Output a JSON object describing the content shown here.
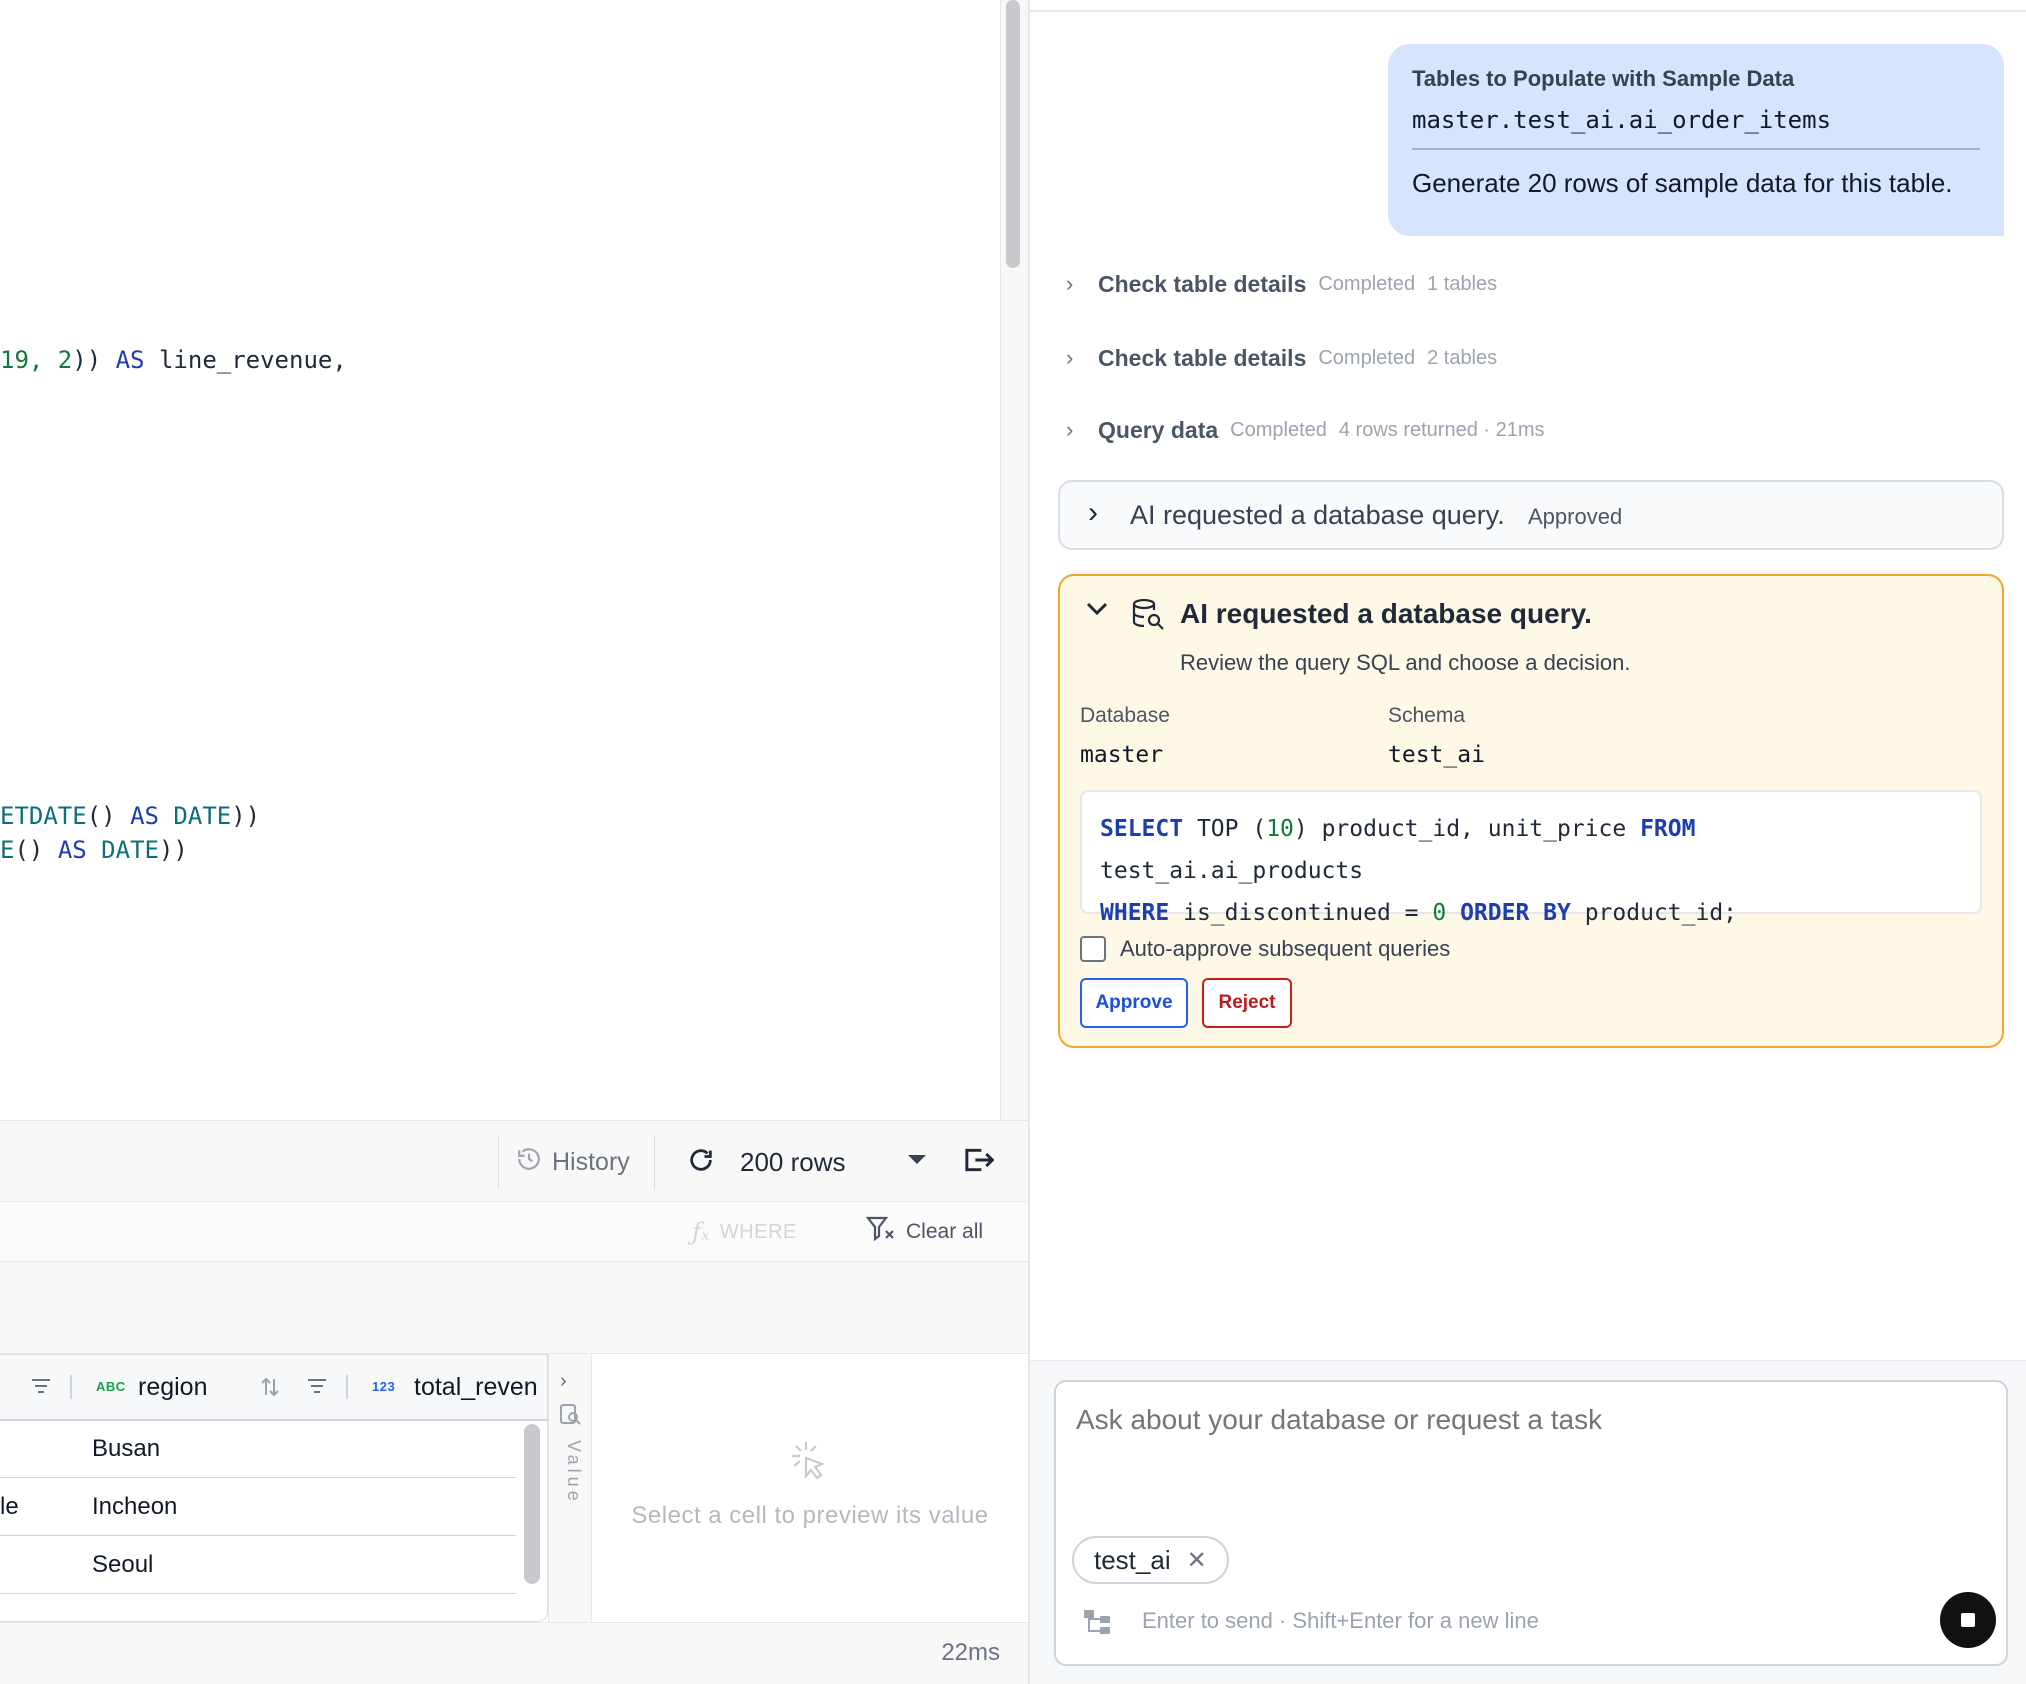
{
  "editor": {
    "lines": [
      {
        "segments": [
          {
            "t": "19, ",
            "c": "num"
          },
          {
            "t": "2",
            "c": "num"
          },
          {
            "t": ")) ",
            "c": ""
          },
          {
            "t": "AS",
            "c": "kw"
          },
          {
            "t": " line_revenue,",
            "c": ""
          }
        ]
      },
      {
        "segments": [
          {
            "t": "ETDATE",
            "c": "fn"
          },
          {
            "t": "() ",
            "c": ""
          },
          {
            "t": "AS",
            "c": "kw"
          },
          {
            "t": " ",
            "c": ""
          },
          {
            "t": "DATE",
            "c": "fn"
          },
          {
            "t": "))",
            "c": ""
          }
        ]
      },
      {
        "segments": [
          {
            "t": "E",
            "c": "fn"
          },
          {
            "t": "() ",
            "c": ""
          },
          {
            "t": "AS",
            "c": "kw"
          },
          {
            "t": " ",
            "c": ""
          },
          {
            "t": "DATE",
            "c": "fn"
          },
          {
            "t": "))",
            "c": ""
          }
        ]
      }
    ]
  },
  "toolbar": {
    "history_label": "History",
    "rows_label": "200 rows"
  },
  "filterbar": {
    "where_label": "WHERE",
    "clear_all_label": "Clear all"
  },
  "grid": {
    "columns": [
      {
        "type_badge": "ABC",
        "label": "region"
      },
      {
        "type_badge": "123",
        "label": "total_reven"
      }
    ],
    "rows": [
      {
        "left_fragment": "",
        "region": "Busan"
      },
      {
        "left_fragment": "le",
        "region": "Incheon"
      },
      {
        "left_fragment": "",
        "region": "Seoul"
      }
    ]
  },
  "value_panel": {
    "tab_label": "Value",
    "hint": "Select a cell to preview its value"
  },
  "status": {
    "elapsed": "22ms"
  },
  "chat": {
    "user_message": {
      "title": "Tables to Populate with Sample Data",
      "table": "master.test_ai.ai_order_items",
      "text": "Generate 20 rows of sample data for this table."
    },
    "steps": [
      {
        "title": "Check table details",
        "status": "Completed",
        "detail": "1 tables"
      },
      {
        "title": "Check table details",
        "status": "Completed",
        "detail": "2 tables"
      },
      {
        "title": "Query data",
        "status": "Completed",
        "detail": "4 rows returned · 21ms"
      }
    ],
    "approved_request": {
      "title": "AI requested a database query.",
      "status": "Approved"
    },
    "pending_request": {
      "title": "AI requested a database query.",
      "subtitle": "Review the query SQL and choose a decision.",
      "database_label": "Database",
      "database_value": "master",
      "schema_label": "Schema",
      "schema_value": "test_ai",
      "sql_line1": [
        {
          "t": "SELECT",
          "c": "kw"
        },
        {
          "t": " TOP (",
          "c": ""
        },
        {
          "t": "10",
          "c": "num"
        },
        {
          "t": ") product_id, unit_price ",
          "c": ""
        },
        {
          "t": "FROM",
          "c": "kw"
        },
        {
          "t": " test_ai.ai_products",
          "c": ""
        }
      ],
      "sql_line2": [
        {
          "t": "WHERE",
          "c": "kw"
        },
        {
          "t": " is_discontinued = ",
          "c": ""
        },
        {
          "t": "0",
          "c": "num"
        },
        {
          "t": " ",
          "c": ""
        },
        {
          "t": "ORDER BY",
          "c": "kw"
        },
        {
          "t": " product_id;",
          "c": ""
        }
      ],
      "auto_approve_label": "Auto-approve subsequent queries",
      "approve_label": "Approve",
      "reject_label": "Reject"
    },
    "composer": {
      "placeholder": "Ask about your database or request a task",
      "context_chip": "test_ai",
      "hint": "Enter to send · Shift+Enter for a new line"
    }
  },
  "colors": {
    "accent_blue": "#1d4ed8",
    "warning_border": "#f4a62a",
    "reject_red": "#b91c1c",
    "user_bubble": "#d6e4fd"
  }
}
